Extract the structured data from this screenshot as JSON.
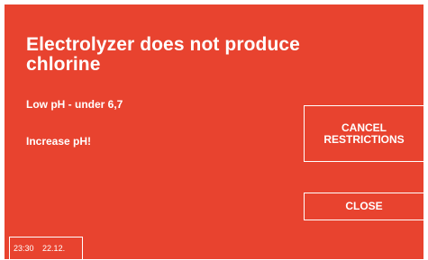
{
  "alert": {
    "title": "Electrolyzer does not produce chlorine",
    "message": "Low pH - under 6,7",
    "instruction": "Increase pH!"
  },
  "buttons": {
    "cancel_restrictions": "CANCEL RESTRICTIONS",
    "close": "CLOSE"
  },
  "status": {
    "time": "23:30",
    "date": "22.12."
  },
  "colors": {
    "background": "#e8432f",
    "text": "#ffffff"
  }
}
